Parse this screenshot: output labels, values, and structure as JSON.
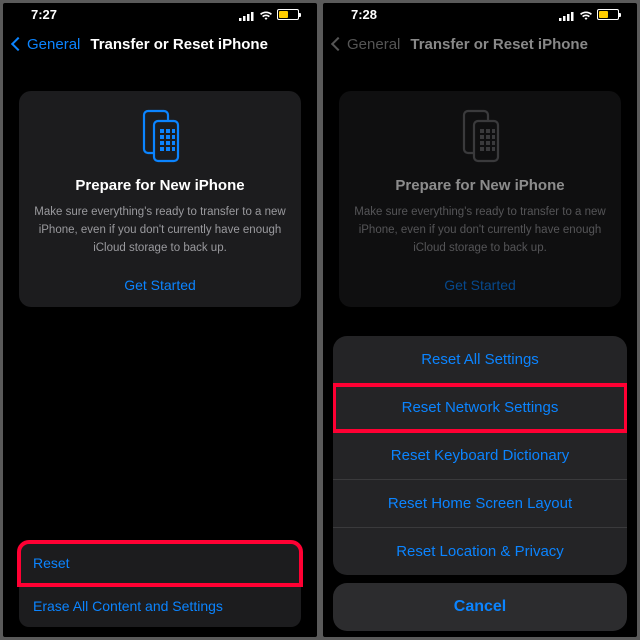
{
  "left": {
    "status": {
      "time": "7:27"
    },
    "nav": {
      "back": "General",
      "title": "Transfer or Reset iPhone"
    },
    "card": {
      "title": "Prepare for New iPhone",
      "desc": "Make sure everything's ready to transfer to a new iPhone, even if you don't currently have enough iCloud storage to back up.",
      "cta": "Get Started"
    },
    "rows": {
      "reset": "Reset",
      "erase": "Erase All Content and Settings"
    }
  },
  "right": {
    "status": {
      "time": "7:28"
    },
    "nav": {
      "back": "General",
      "title": "Transfer or Reset iPhone"
    },
    "card": {
      "title": "Prepare for New iPhone",
      "desc": "Make sure everything's ready to transfer to a new iPhone, even if you don't currently have enough iCloud storage to back up.",
      "cta": "Get Started"
    },
    "sheet": {
      "items": {
        "all": "Reset All Settings",
        "network": "Reset Network Settings",
        "keyboard": "Reset Keyboard Dictionary",
        "home": "Reset Home Screen Layout",
        "location": "Reset Location & Privacy"
      },
      "cancel": "Cancel"
    }
  }
}
